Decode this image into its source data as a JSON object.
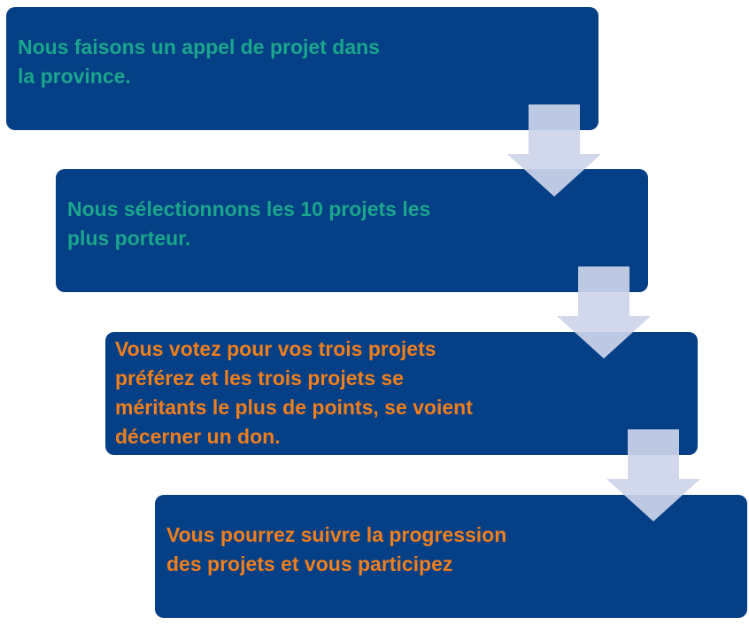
{
  "steps": [
    {
      "text": "Nous faisons un appel de projet dans\nla province.",
      "color": "#1aa68c"
    },
    {
      "text": "Nous sélectionnons les 10 projets les\nplus porteur.",
      "color": "#1aa68c"
    },
    {
      "text": "Vous votez pour vos trois projets\npréférez et les trois projets se\nméritants le plus de points, se voient\ndécerner un don.",
      "color": "#f07f1b"
    },
    {
      "text": "Vous pourrez suivre la progression\ndes projets et vous participez",
      "color": "#f07f1b"
    }
  ],
  "colors": {
    "box": "#053f85",
    "arrow": "#cdd5ea",
    "background": "#ffffff"
  },
  "icons": {
    "connector": "down-arrow-icon"
  }
}
